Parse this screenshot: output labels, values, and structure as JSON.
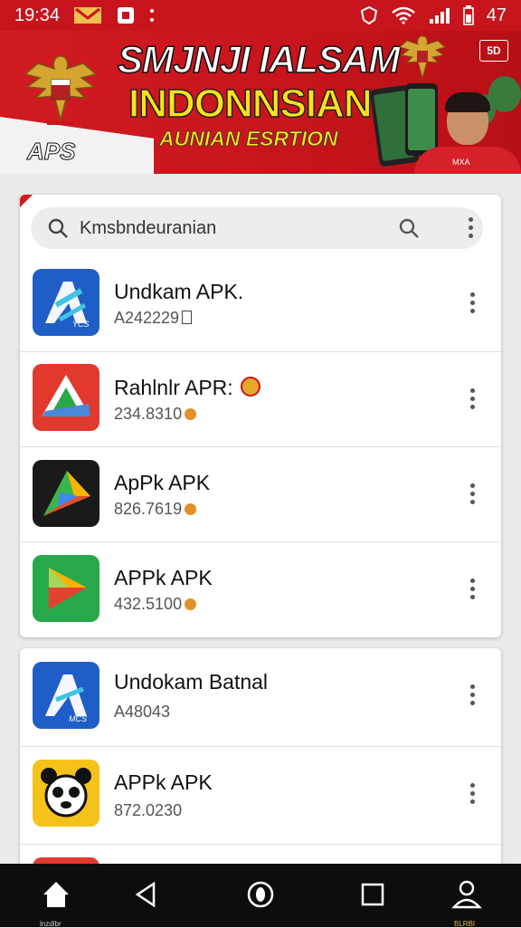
{
  "status_bar": {
    "time": "19:34",
    "battery": "47",
    "bg_color": "#c8141c"
  },
  "banner": {
    "title_line1": "SMJNJI IALSAM",
    "title_line2": "INDONNSIAN",
    "subtitle": "AUNIAN ESRTION",
    "corner_label": "APS",
    "badge": "5D",
    "shirt_text": "MXA",
    "accent_color": "#ffe21b",
    "bg_color": "#c8141c"
  },
  "search": {
    "value": "Kmsbndeuranian",
    "icon_left": "search-icon",
    "icon_right": "search-icon",
    "menu_icon": "more-vert-icon"
  },
  "apps": [
    {
      "title": "Undkam APK.",
      "subtitle": "A242229",
      "icon": "blue-a-app-icon",
      "menu_icon": "more-vert-icon",
      "icon_caption": "YCS"
    },
    {
      "title": "Rahlnlr APR:",
      "subtitle": "234.8310",
      "icon": "red-triangle-app-icon",
      "menu_icon": "more-vert-icon"
    },
    {
      "title": "ApPk APK",
      "subtitle": "826.7619",
      "icon": "dark-play-app-icon",
      "menu_icon": "more-vert-icon"
    },
    {
      "title": "APPk APK",
      "subtitle": "432.5100",
      "icon": "green-play-app-icon",
      "menu_icon": "more-vert-icon"
    }
  ],
  "apps2": [
    {
      "title": "Undokam Batnal",
      "subtitle": "A48043",
      "icon": "blue-a-app-icon",
      "menu_icon": "more-vert-icon",
      "icon_caption": "MCS"
    },
    {
      "title": "APPk APK",
      "subtitle": "872.0230",
      "icon": "yellow-panda-app-icon",
      "menu_icon": "more-vert-icon"
    }
  ],
  "navbar": {
    "home_label": "lnzdlbr",
    "profile_label": "BLRBI",
    "icons": [
      "home-icon",
      "back-icon",
      "home-circle-icon",
      "recents-icon",
      "profile-icon"
    ]
  }
}
